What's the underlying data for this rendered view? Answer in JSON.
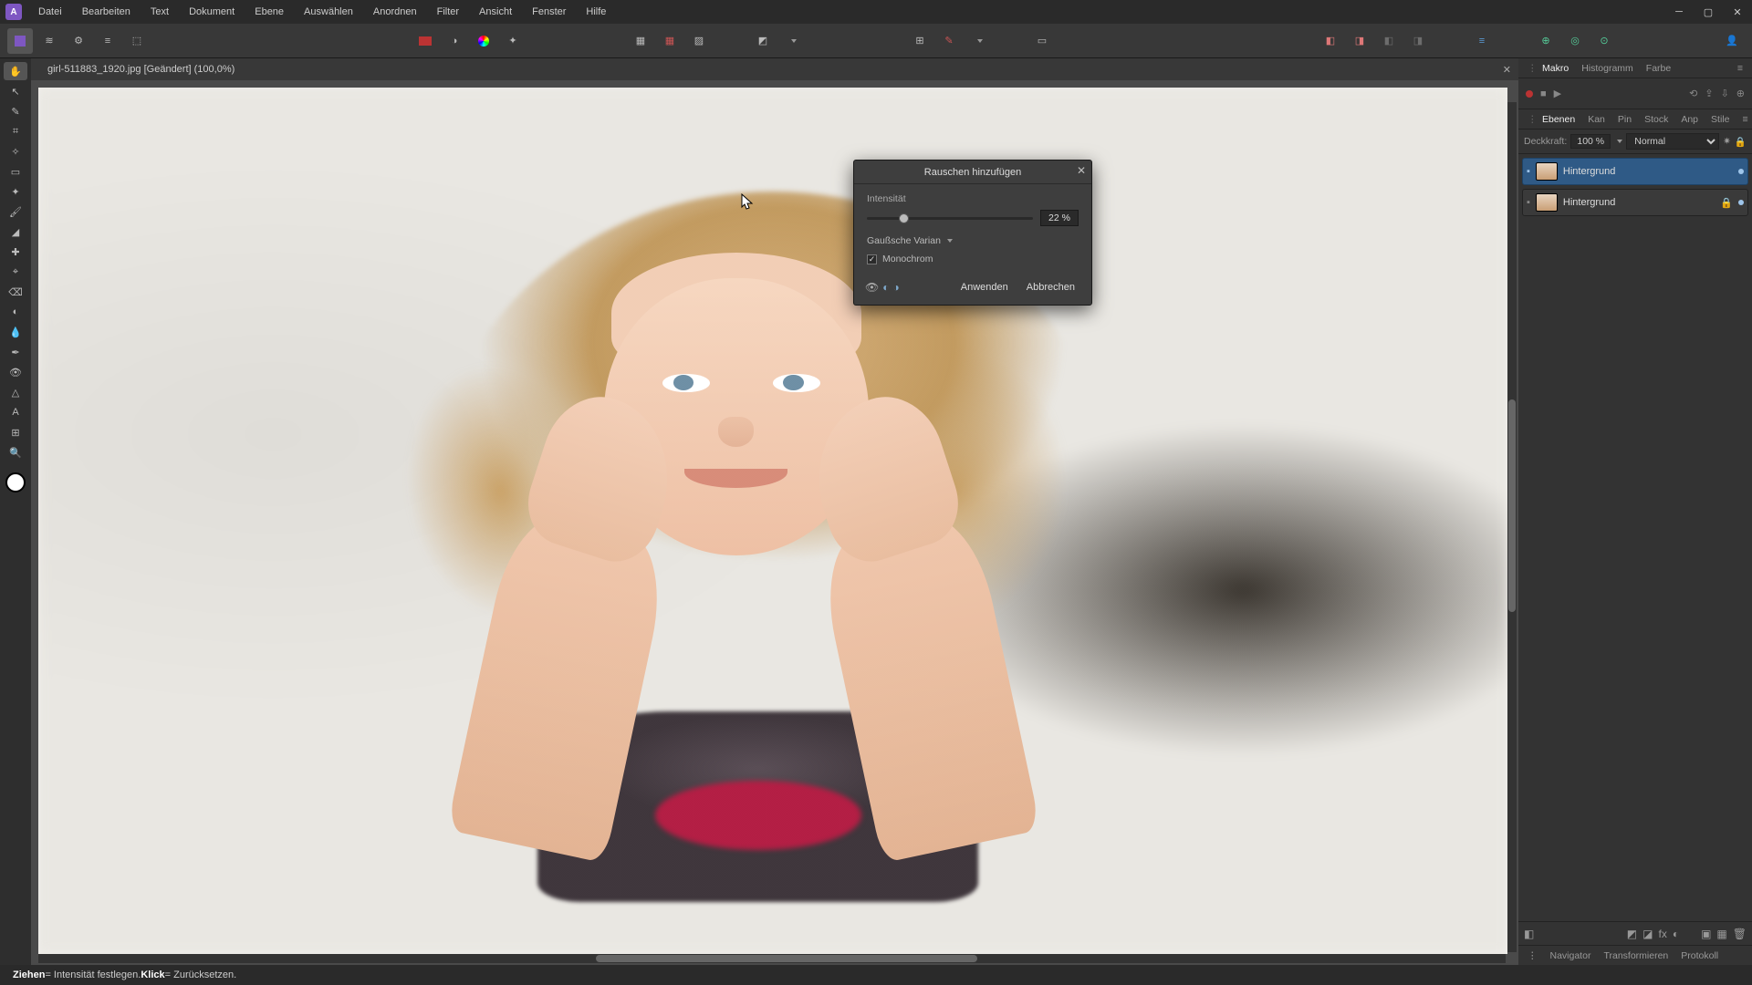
{
  "app": {
    "logo_letter": "A"
  },
  "menu": {
    "items": [
      "Datei",
      "Bearbeiten",
      "Text",
      "Dokument",
      "Ebene",
      "Auswählen",
      "Anordnen",
      "Filter",
      "Ansicht",
      "Fenster",
      "Hilfe"
    ]
  },
  "document": {
    "tab_title": "girl-511883_1920.jpg [Geändert] (100,0%)"
  },
  "statusbar": {
    "drag_word": "Ziehen",
    "drag_rest": " = Intensität festlegen. ",
    "click_word": "Klick",
    "click_rest": " = Zurücksetzen."
  },
  "dialog": {
    "title": "Rauschen hinzufügen",
    "intensity_label": "Intensität",
    "intensity_value": "22 %",
    "intensity_percent": 22,
    "distribution_label": "Gaußsche Varian",
    "mono_label": "Monochrom",
    "mono_checked": true,
    "apply": "Anwenden",
    "cancel": "Abbrechen"
  },
  "panels": {
    "top_tabs": [
      "Makro",
      "Histogramm",
      "Farbe"
    ],
    "mid_tabs": [
      "Ebenen",
      "Kan",
      "Pin",
      "Stock",
      "Anp",
      "Stile"
    ],
    "opacity_label": "Deckkraft:",
    "opacity_value": "100 %",
    "blend_mode": "Normal",
    "layers": [
      {
        "name": "Hintergrund",
        "selected": true,
        "locked": false
      },
      {
        "name": "Hintergrund",
        "selected": false,
        "locked": true
      }
    ],
    "bottom_tabs": [
      "Navigator",
      "Transformieren",
      "Protokoll"
    ]
  },
  "tooltips": {
    "hand": "hand-tool",
    "move": "move-tool",
    "node": "node-tool",
    "crop": "crop-tool",
    "wand": "selection-brush-tool",
    "marquee": "marquee-tool",
    "flood": "flood-select-tool",
    "brush": "paint-brush-tool",
    "erase": "erase-brush-tool",
    "clone": "clone-brush-tool",
    "heal": "healing-brush-tool",
    "dodge": "dodge-brush-tool",
    "blur": "blur-brush-tool",
    "pen": "pen-tool",
    "shape": "shape-tool",
    "text": "text-tool",
    "mesh": "mesh-warp-tool",
    "picker": "color-picker-tool",
    "zoom": "zoom-tool"
  }
}
